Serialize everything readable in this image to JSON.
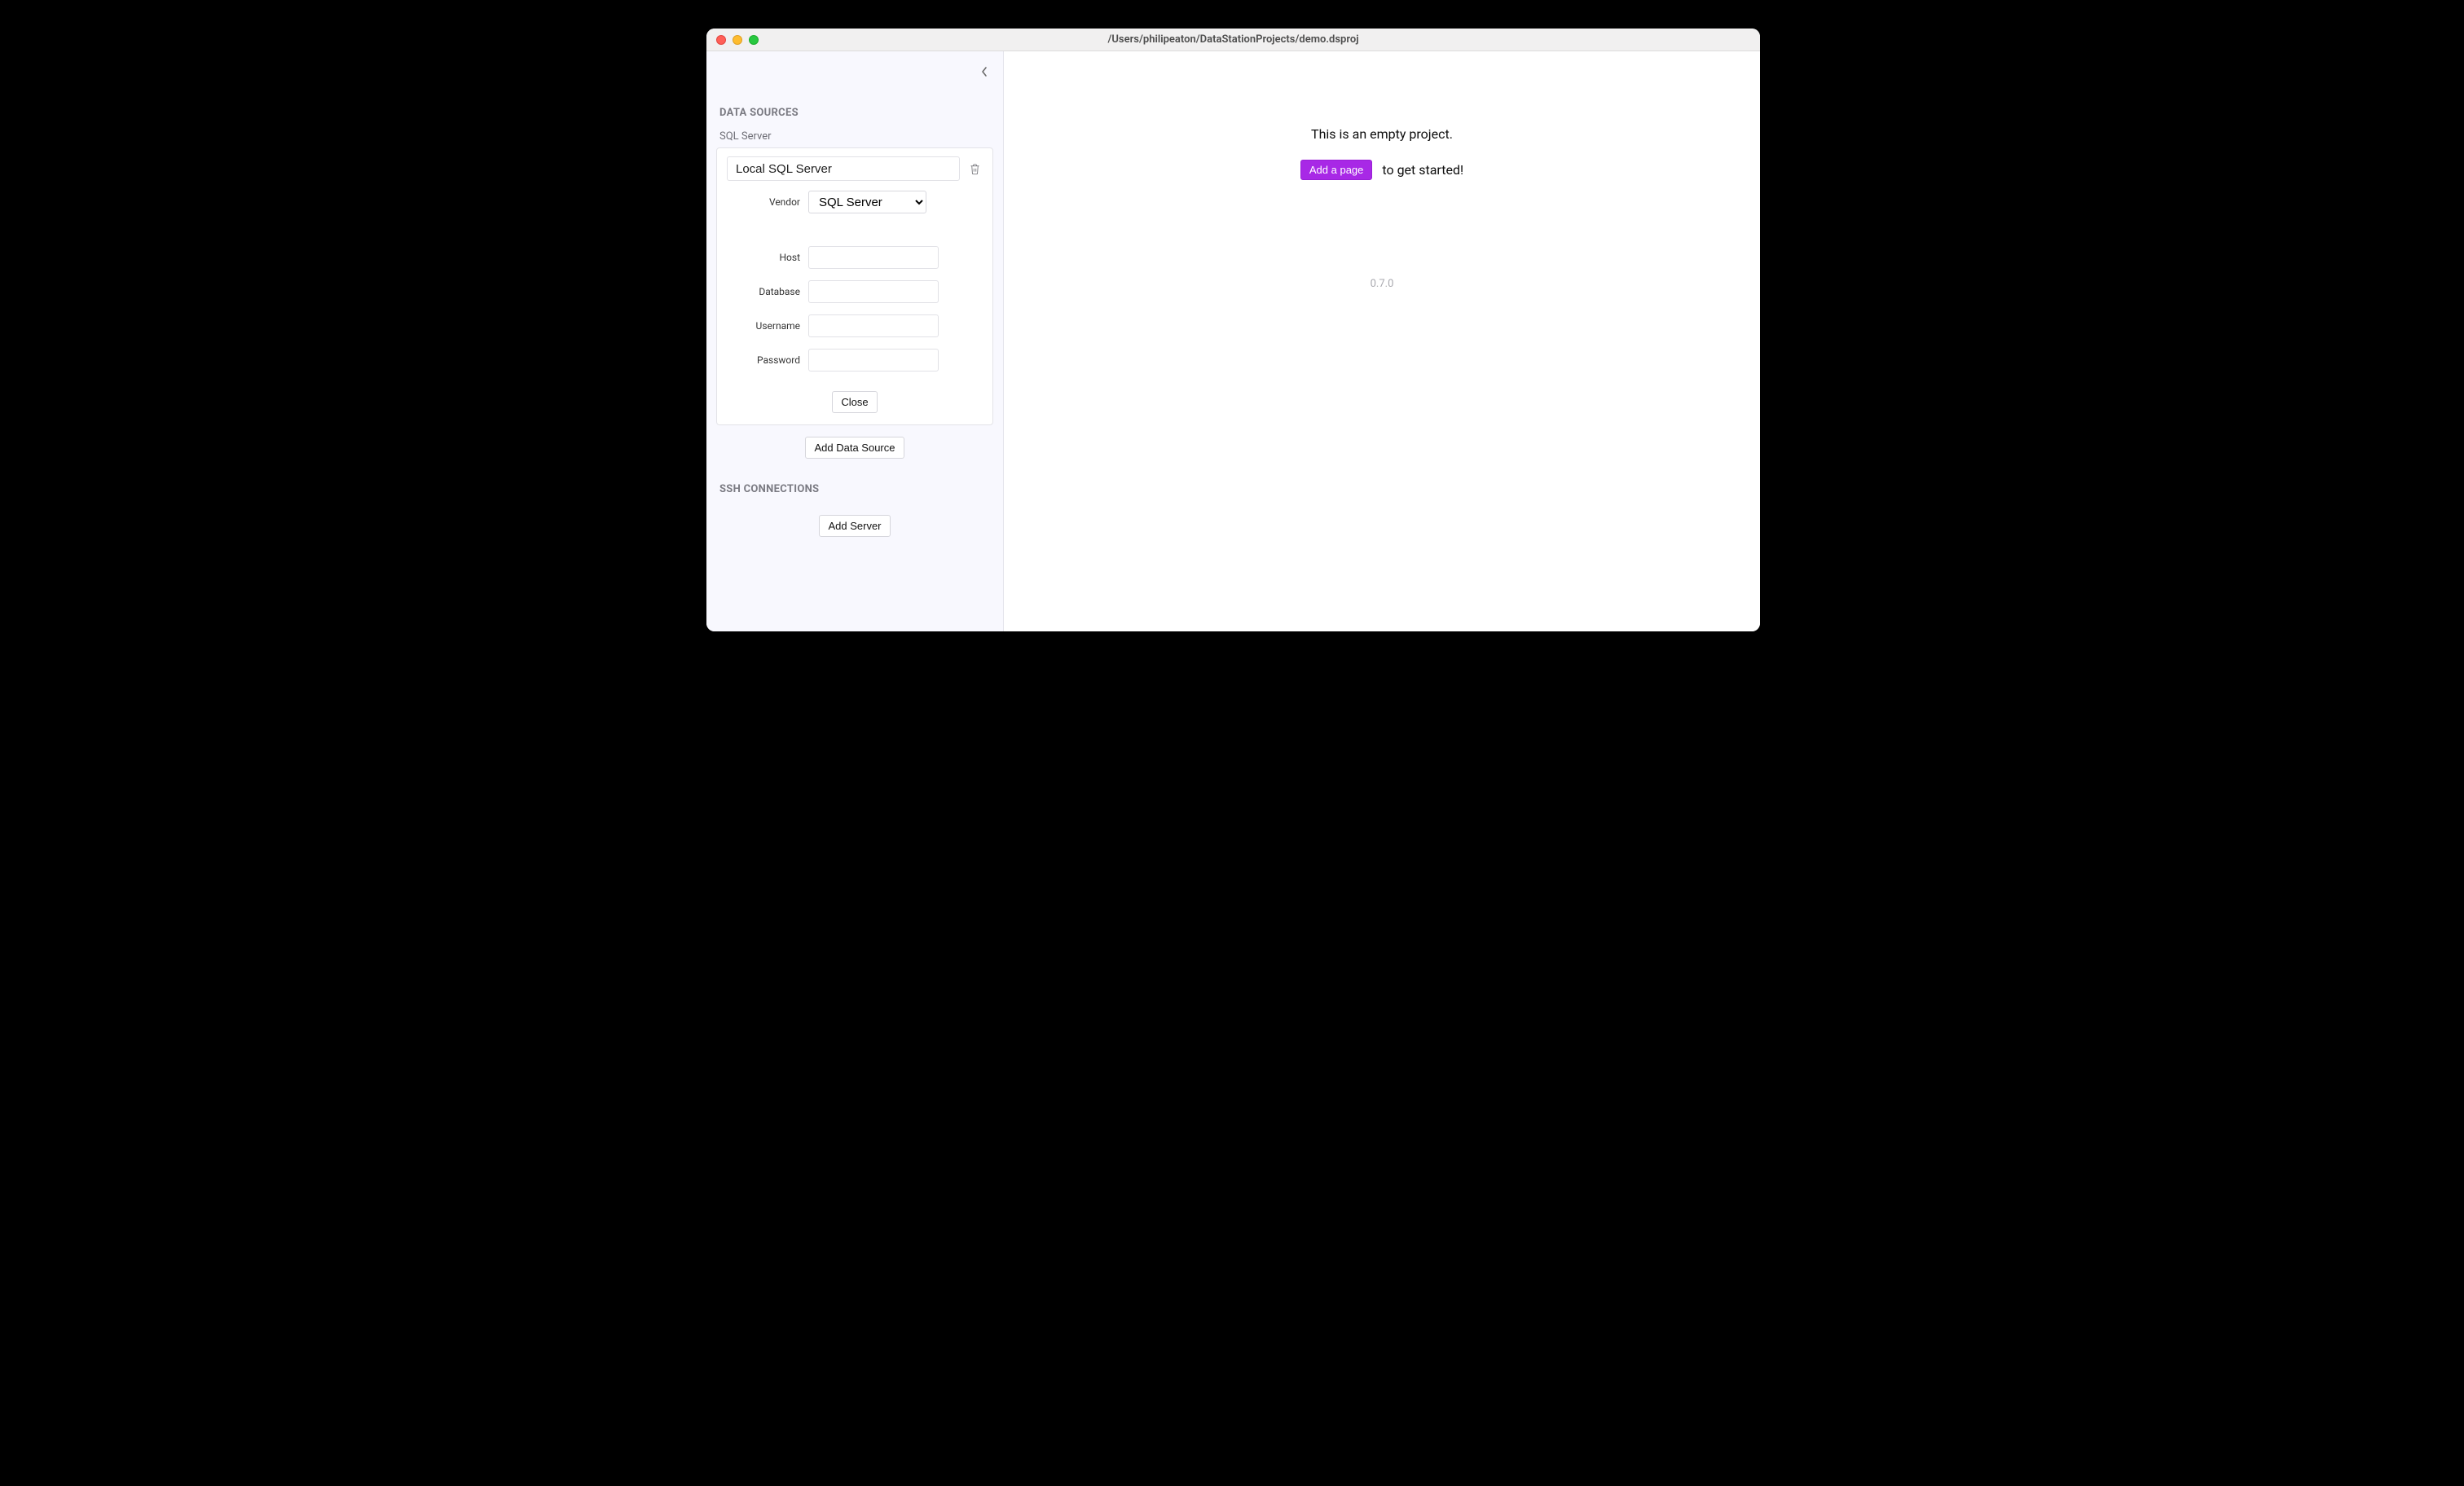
{
  "window": {
    "title": "/Users/philipeaton/DataStationProjects/demo.dsproj"
  },
  "sidebar": {
    "data_sources_header": "DATA SOURCES",
    "data_source_type_label": "SQL Server",
    "ds_card": {
      "name_value": "Local SQL Server",
      "vendor_label": "Vendor",
      "vendor_value": "SQL Server",
      "host_label": "Host",
      "host_value": "",
      "database_label": "Database",
      "database_value": "",
      "username_label": "Username",
      "username_value": "",
      "password_label": "Password",
      "password_value": "",
      "close_label": "Close"
    },
    "add_data_source_label": "Add Data Source",
    "ssh_header": "SSH CONNECTIONS",
    "add_server_label": "Add Server"
  },
  "main": {
    "empty_message": "This is an empty project.",
    "add_page_label": "Add a page",
    "cta_suffix": "to get started!",
    "version": "0.7.0"
  }
}
